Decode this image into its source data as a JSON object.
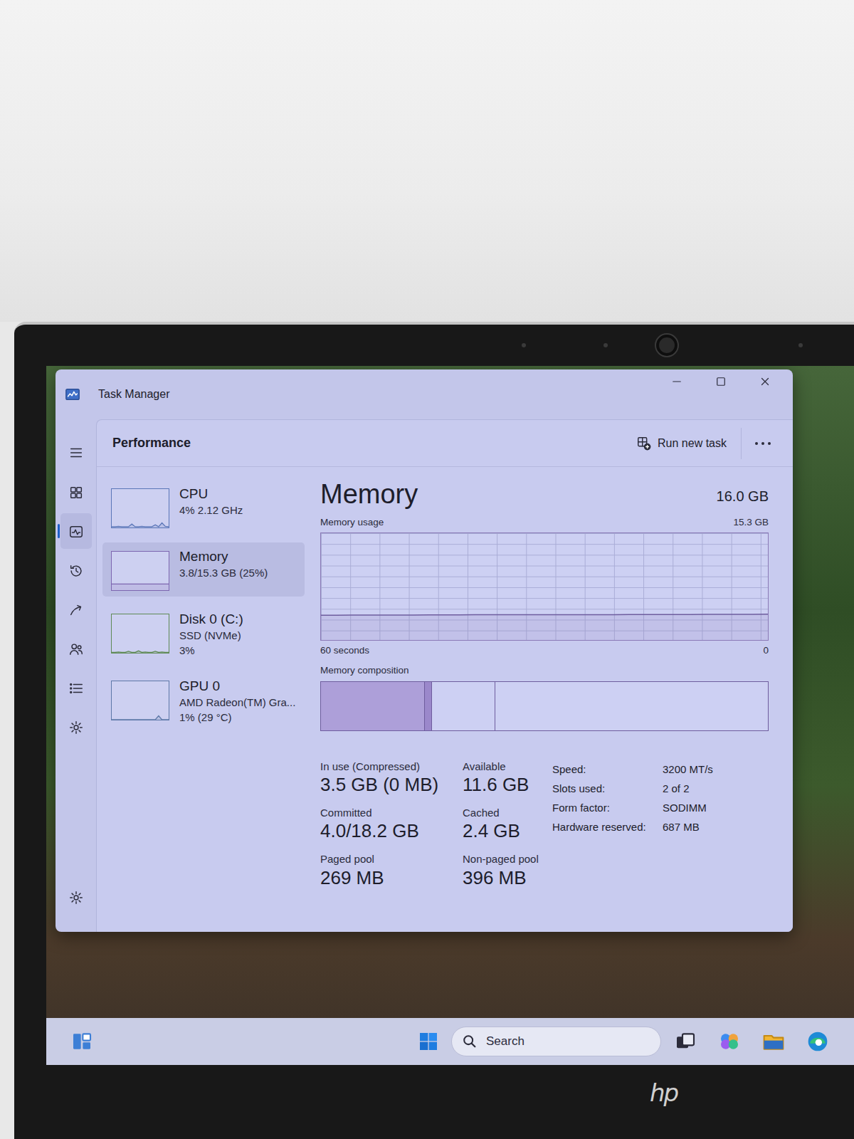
{
  "laptop": {
    "logo": "hp"
  },
  "window": {
    "title": "Task Manager"
  },
  "nav": [
    {
      "kind": "processes",
      "selected": false
    },
    {
      "kind": "performance",
      "selected": true
    },
    {
      "kind": "app-history",
      "selected": false
    },
    {
      "kind": "startup",
      "selected": false
    },
    {
      "kind": "users",
      "selected": false
    },
    {
      "kind": "details",
      "selected": false
    },
    {
      "kind": "services",
      "selected": false
    }
  ],
  "header": {
    "title": "Performance",
    "run_task": "Run new task"
  },
  "devices": [
    {
      "name": "CPU",
      "lines": [
        "4% 2.12 GHz"
      ],
      "selected": false,
      "color": "#5a76b8",
      "values": [
        2,
        2,
        3,
        2,
        2,
        2,
        9,
        2,
        2,
        3,
        2,
        2,
        2,
        7,
        2,
        12,
        3,
        2
      ]
    },
    {
      "name": "Memory",
      "lines": [
        "3.8/15.3 GB (25%)"
      ],
      "selected": true,
      "color": "#7d66b0",
      "values": [
        16,
        16,
        16,
        16,
        16,
        16,
        16,
        16,
        16,
        16,
        16,
        16,
        16,
        16,
        16,
        16,
        16,
        16
      ]
    },
    {
      "name": "Disk 0 (C:)",
      "lines": [
        "SSD (NVMe)",
        "3%"
      ],
      "selected": false,
      "color": "#5f8a56",
      "values": [
        1,
        1,
        2,
        1,
        1,
        4,
        1,
        1,
        5,
        1,
        2,
        1,
        1,
        4,
        1,
        2,
        1,
        1
      ]
    },
    {
      "name": "GPU 0",
      "lines": [
        "AMD Radeon(TM) Gra...",
        "1% (29 °C)"
      ],
      "selected": false,
      "color": "#5d78a8",
      "values": [
        0,
        0,
        0,
        0,
        0,
        0,
        0,
        0,
        0,
        0,
        0,
        0,
        0,
        0,
        10,
        0,
        0,
        0
      ]
    }
  ],
  "detail": {
    "title": "Memory",
    "total": "16.0 GB",
    "usage_label": "Memory usage",
    "max_label": "15.3 GB",
    "axis_max": 15.3,
    "usage_values": [
      3.55,
      3.55,
      3.56,
      3.56,
      3.57,
      3.58,
      3.58,
      3.59,
      3.6,
      3.6,
      3.61,
      3.61,
      3.62,
      3.62,
      3.63,
      3.63,
      3.62,
      3.62,
      3.63,
      3.63,
      3.64,
      3.64,
      3.64,
      3.65,
      3.65,
      3.66,
      3.66,
      3.67,
      3.68,
      3.7
    ],
    "time_left": "60 seconds",
    "time_right": "0",
    "composition_label": "Memory composition",
    "composition": [
      {
        "kind": "in-use",
        "level": 0.232
      },
      {
        "kind": "modified",
        "level": 0.016
      },
      {
        "kind": "standby",
        "level": 0.142
      },
      {
        "kind": "free",
        "level": 0.61
      }
    ],
    "stats": [
      [
        {
          "label": "In use (Compressed)",
          "value": "3.5 GB (0 MB)"
        },
        {
          "label": "Available",
          "value": "11.6 GB"
        }
      ],
      [
        {
          "label": "Committed",
          "value": "4.0/18.2 GB"
        },
        {
          "label": "Cached",
          "value": "2.4 GB"
        }
      ],
      [
        {
          "label": "Paged pool",
          "value": "269 MB"
        },
        {
          "label": "Non-paged pool",
          "value": "396 MB"
        }
      ]
    ],
    "specs": [
      {
        "label": "Speed:",
        "value": "3200 MT/s"
      },
      {
        "label": "Slots used:",
        "value": "2 of 2"
      },
      {
        "label": "Form factor:",
        "value": "SODIMM"
      },
      {
        "label": "Hardware reserved:",
        "value": "687 MB"
      }
    ]
  },
  "taskbar": {
    "search": "Search"
  }
}
